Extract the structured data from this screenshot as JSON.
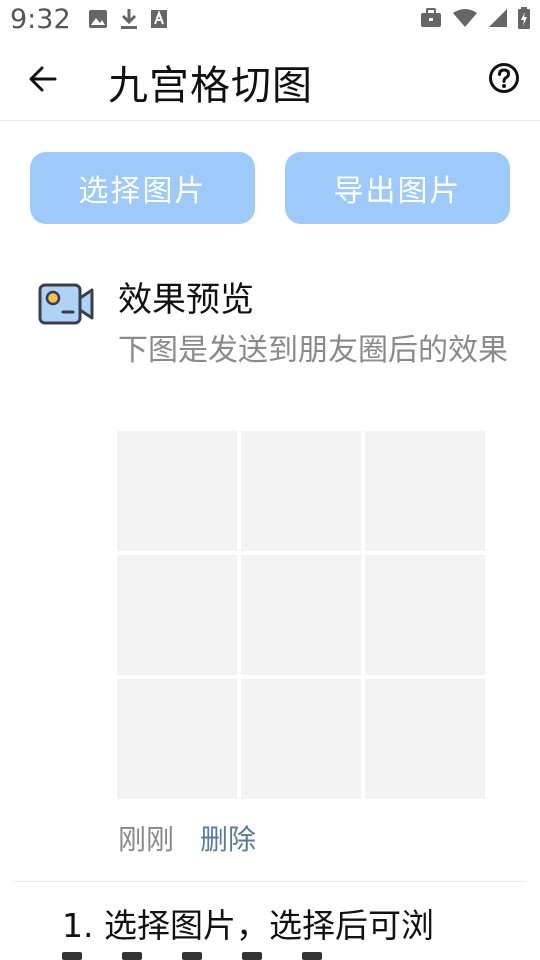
{
  "status_bar": {
    "time": "9:32",
    "icons_left": [
      "image-icon",
      "download-icon",
      "font-icon"
    ],
    "icons_right": [
      "briefcase-icon",
      "wifi-icon",
      "signal-icon",
      "battery-icon"
    ]
  },
  "app_bar": {
    "title": "九宫格切图",
    "back_icon": "arrow-left-icon",
    "help_icon": "help-circle-icon"
  },
  "actions": {
    "select_label": "选择图片",
    "export_label": "导出图片"
  },
  "preview": {
    "title": "效果预览",
    "description": "下图是发送到朋友圈后的效果",
    "grid_cells": 9,
    "time": "刚刚",
    "delete_label": "删除"
  },
  "instruction": {
    "step1": "1. 选择图片，选择后可浏"
  },
  "colors": {
    "button_bg": "#9ec9fb",
    "cell_bg": "#f3f3f3",
    "link": "#5b7aa3"
  }
}
